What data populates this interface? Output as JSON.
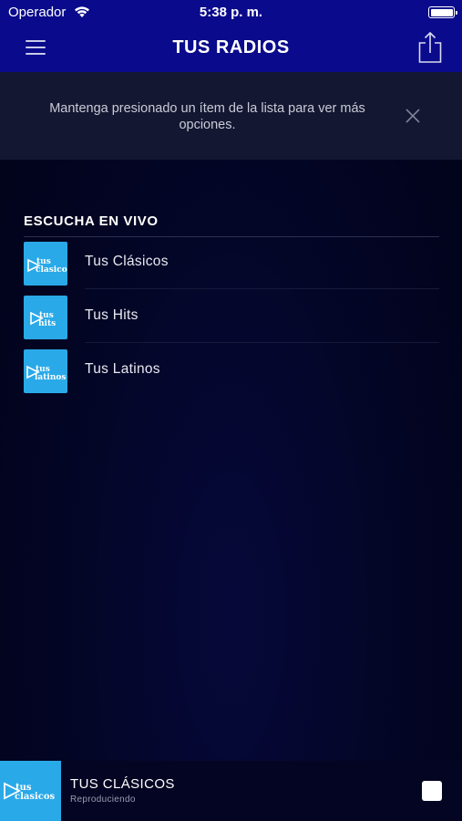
{
  "status_bar": {
    "carrier": "Operador",
    "time": "5:38 p. m."
  },
  "nav": {
    "title": "TUS RADIOS"
  },
  "hint": {
    "text": "Mantenga presionado un ítem de la lista para ver más opciones."
  },
  "section": {
    "title": "ESCUCHA EN VIVO",
    "items": [
      {
        "label": "Tus Clásicos",
        "logo_text": "tus clasicos"
      },
      {
        "label": "Tus Hits",
        "logo_text": "tus hits"
      },
      {
        "label": "Tus Latinos",
        "logo_text": "tus latinos"
      }
    ]
  },
  "player": {
    "title": "TUS CLÁSICOS",
    "status": "Reproduciendo",
    "logo_text": "tus clasicos"
  },
  "colors": {
    "nav_bg": "#0a0a8c",
    "logo_bg": "#29a9e8",
    "body_bg": "#030524"
  }
}
